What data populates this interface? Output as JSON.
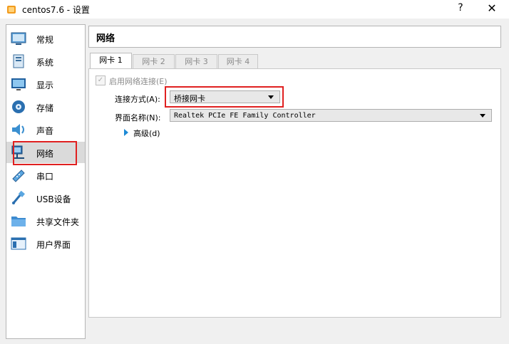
{
  "window": {
    "title": "centos7.6 - 设置",
    "help_label": "?",
    "close_label": "✕"
  },
  "sidebar": {
    "items": [
      {
        "label": "常规",
        "icon": "general-icon"
      },
      {
        "label": "系统",
        "icon": "system-icon"
      },
      {
        "label": "显示",
        "icon": "display-icon"
      },
      {
        "label": "存储",
        "icon": "storage-icon"
      },
      {
        "label": "声音",
        "icon": "audio-icon"
      },
      {
        "label": "网络",
        "icon": "network-icon",
        "selected": true
      },
      {
        "label": "串口",
        "icon": "serial-port-icon"
      },
      {
        "label": "USB设备",
        "icon": "usb-icon"
      },
      {
        "label": "共享文件夹",
        "icon": "shared-folder-icon"
      },
      {
        "label": "用户界面",
        "icon": "user-interface-icon"
      }
    ]
  },
  "header": {
    "title": "网络"
  },
  "tabs": [
    "网卡 1",
    "网卡 2",
    "网卡 3",
    "网卡 4"
  ],
  "adapter": {
    "enable_label": "启用网络连接(E)",
    "enabled": true,
    "attached_label": "连接方式(A):",
    "attached_value": "桥接网卡",
    "name_label": "界面名称(N):",
    "name_value": "Realtek PCIe FE Family Controller",
    "advanced_label": "高级(d)"
  },
  "colors": {
    "highlight_box": "#e02020",
    "selected_row": "#dadada",
    "expander": "#1e8ad6"
  }
}
